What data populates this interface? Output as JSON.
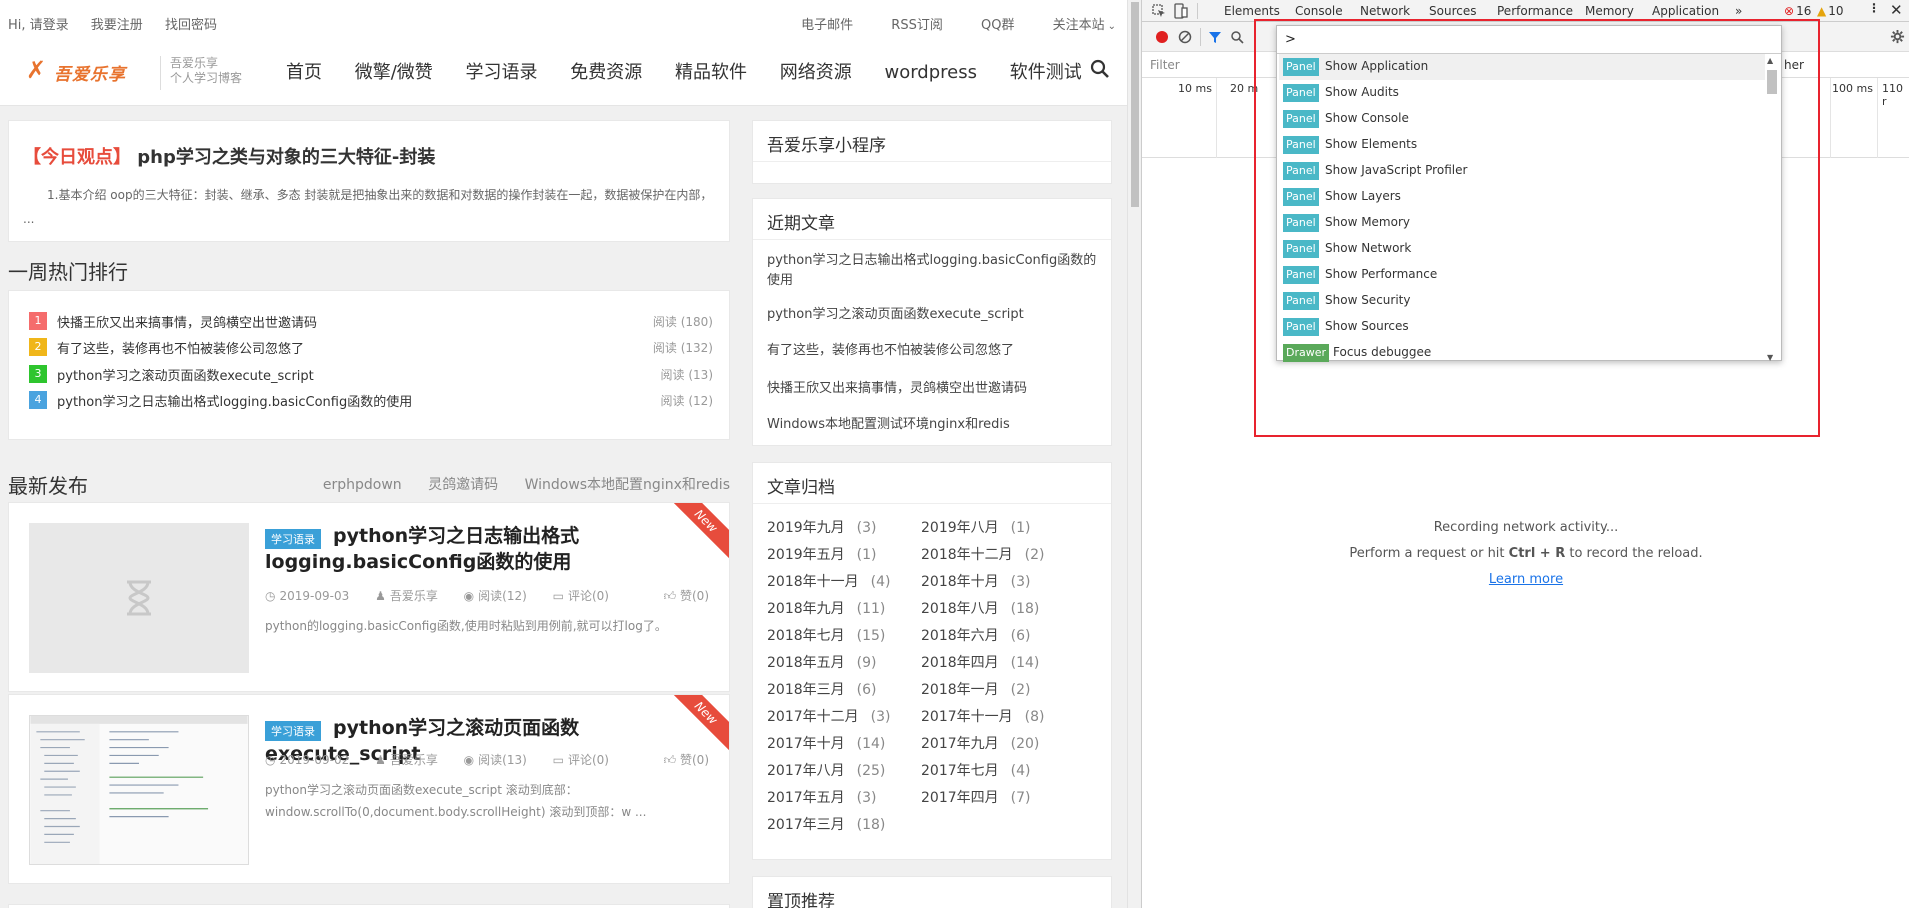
{
  "site": {
    "topbar": {
      "left": [
        "Hi, 请登录",
        "我要注册",
        "找回密码"
      ],
      "right": [
        "电子邮件",
        "RSS订阅",
        "QQ群",
        "关注本站"
      ]
    },
    "logo": {
      "text": "吾爱乐享",
      "slogan_1": "吾爱乐享",
      "slogan_2": "个人学习博客"
    },
    "nav": [
      "首页",
      "微擎/微赞",
      "学习语录",
      "免费资源",
      "精品软件",
      "网络资源",
      "wordpress",
      "软件测试"
    ],
    "today": {
      "tag": "【今日观点】",
      "title": "php学习之类与对象的三大特征-封装",
      "desc": "1.基本介绍 oop的三大特征：封装、继承、多态 封装就是把抽象出来的数据和对数据的操作封装在一起，数据被保护在内部， ..."
    },
    "hot": {
      "title": "一周热门排行",
      "items": [
        {
          "num": "1",
          "title": "快播王欣又出来搞事情，灵鸽横空出世邀请码",
          "views": "阅读 (180)",
          "color": "#f56c6c"
        },
        {
          "num": "2",
          "title": "有了这些，装修再也不怕被装修公司忽悠了",
          "views": "阅读 (132)",
          "color": "#f0b61a"
        },
        {
          "num": "3",
          "title": "python学习之滚动页面函数execute_script",
          "views": "阅读 (13)",
          "color": "#2ec52e"
        },
        {
          "num": "4",
          "title": "python学习之日志输出格式logging.basicConfig函数的使用",
          "views": "阅读 (12)",
          "color": "#4aa3df"
        }
      ]
    },
    "latest": {
      "title": "最新发布",
      "tabs": [
        "erphpdown",
        "灵鸽邀请码",
        "Windows本地配置nginx和redis"
      ],
      "posts": [
        {
          "category": "学习语录",
          "title": "python学习之日志输出格式logging.basicConfig函数的使用",
          "date": "2019-09-03",
          "author": "吾爱乐享",
          "views": "阅读(12)",
          "comments": "评论(0)",
          "likes": "赞(0)",
          "excerpt": "python的logging.basicConfig函数,使用时粘贴到用例前,就可以打log了。",
          "ribbon": "New"
        },
        {
          "category": "学习语录",
          "title": "python学习之滚动页面函数execute_script",
          "date": "2019-09-02",
          "author": "吾爱乐享",
          "views": "阅读(13)",
          "comments": "评论(0)",
          "likes": "赞(0)",
          "excerpt": "python学习之滚动页面函数execute_script 滚动到底部：window.scrollTo(0,document.body.scrollHeight) 滚动到顶部：w ...",
          "ribbon": "New"
        }
      ]
    },
    "sidebar": {
      "miniapp_title": "吾爱乐享小程序",
      "recent_title": "近期文章",
      "recent": [
        "python学习之日志输出格式logging.basicConfig函数的使用",
        "python学习之滚动页面函数execute_script",
        "有了这些，装修再也不怕被装修公司忽悠了",
        "快播王欣又出来搞事情，灵鸽横空出世邀请码",
        "Windows本地配置测试环境nginx和redis"
      ],
      "archive_title": "文章归档",
      "archive": [
        {
          "m": "2019年九月",
          "c": "(3)"
        },
        {
          "m": "2019年八月",
          "c": "(1)"
        },
        {
          "m": "2019年五月",
          "c": "(1)"
        },
        {
          "m": "2018年十二月",
          "c": "(2)"
        },
        {
          "m": "2018年十一月",
          "c": "(4)"
        },
        {
          "m": "2018年十月",
          "c": "(3)"
        },
        {
          "m": "2018年九月",
          "c": "(11)"
        },
        {
          "m": "2018年八月",
          "c": "(18)"
        },
        {
          "m": "2018年七月",
          "c": "(15)"
        },
        {
          "m": "2018年六月",
          "c": "(6)"
        },
        {
          "m": "2018年五月",
          "c": "(9)"
        },
        {
          "m": "2018年四月",
          "c": "(14)"
        },
        {
          "m": "2018年三月",
          "c": "(6)"
        },
        {
          "m": "2018年一月",
          "c": "(2)"
        },
        {
          "m": "2017年十二月",
          "c": "(3)"
        },
        {
          "m": "2017年十一月",
          "c": "(8)"
        },
        {
          "m": "2017年十月",
          "c": "(14)"
        },
        {
          "m": "2017年九月",
          "c": "(20)"
        },
        {
          "m": "2017年八月",
          "c": "(25)"
        },
        {
          "m": "2017年七月",
          "c": "(4)"
        },
        {
          "m": "2017年五月",
          "c": "(3)"
        },
        {
          "m": "2017年四月",
          "c": "(7)"
        },
        {
          "m": "2017年三月",
          "c": "(18)"
        }
      ],
      "top_title": "置顶推荐"
    }
  },
  "devtools": {
    "tabs": [
      "Elements",
      "Console",
      "Network",
      "Sources",
      "Performance",
      "Memory",
      "Application",
      "»"
    ],
    "errors": "16",
    "warnings": "10",
    "filter_label": "Filter",
    "filter_right": "her",
    "timeline_ticks": [
      "10 ms",
      "20 m",
      "100 ms",
      "110 r"
    ],
    "command_input": ">",
    "commands": [
      {
        "badge": "Panel",
        "label": "Show Application",
        "color": "#4ab8c7"
      },
      {
        "badge": "Panel",
        "label": "Show Audits",
        "color": "#4ab8c7"
      },
      {
        "badge": "Panel",
        "label": "Show Console",
        "color": "#4ab8c7"
      },
      {
        "badge": "Panel",
        "label": "Show Elements",
        "color": "#4ab8c7"
      },
      {
        "badge": "Panel",
        "label": "Show JavaScript Profiler",
        "color": "#4ab8c7"
      },
      {
        "badge": "Panel",
        "label": "Show Layers",
        "color": "#4ab8c7"
      },
      {
        "badge": "Panel",
        "label": "Show Memory",
        "color": "#4ab8c7"
      },
      {
        "badge": "Panel",
        "label": "Show Network",
        "color": "#4ab8c7"
      },
      {
        "badge": "Panel",
        "label": "Show Performance",
        "color": "#4ab8c7"
      },
      {
        "badge": "Panel",
        "label": "Show Security",
        "color": "#4ab8c7"
      },
      {
        "badge": "Panel",
        "label": "Show Sources",
        "color": "#4ab8c7"
      },
      {
        "badge": "Drawer",
        "label": "Focus debuggee",
        "color": "#5aa95a"
      }
    ],
    "empty_state": {
      "line1": "Recording network activity...",
      "line2_pre": "Perform a request or hit ",
      "line2_key": "Ctrl + R",
      "line2_post": " to record the reload.",
      "link": "Learn more"
    },
    "highlight_color": "#e8232e"
  }
}
